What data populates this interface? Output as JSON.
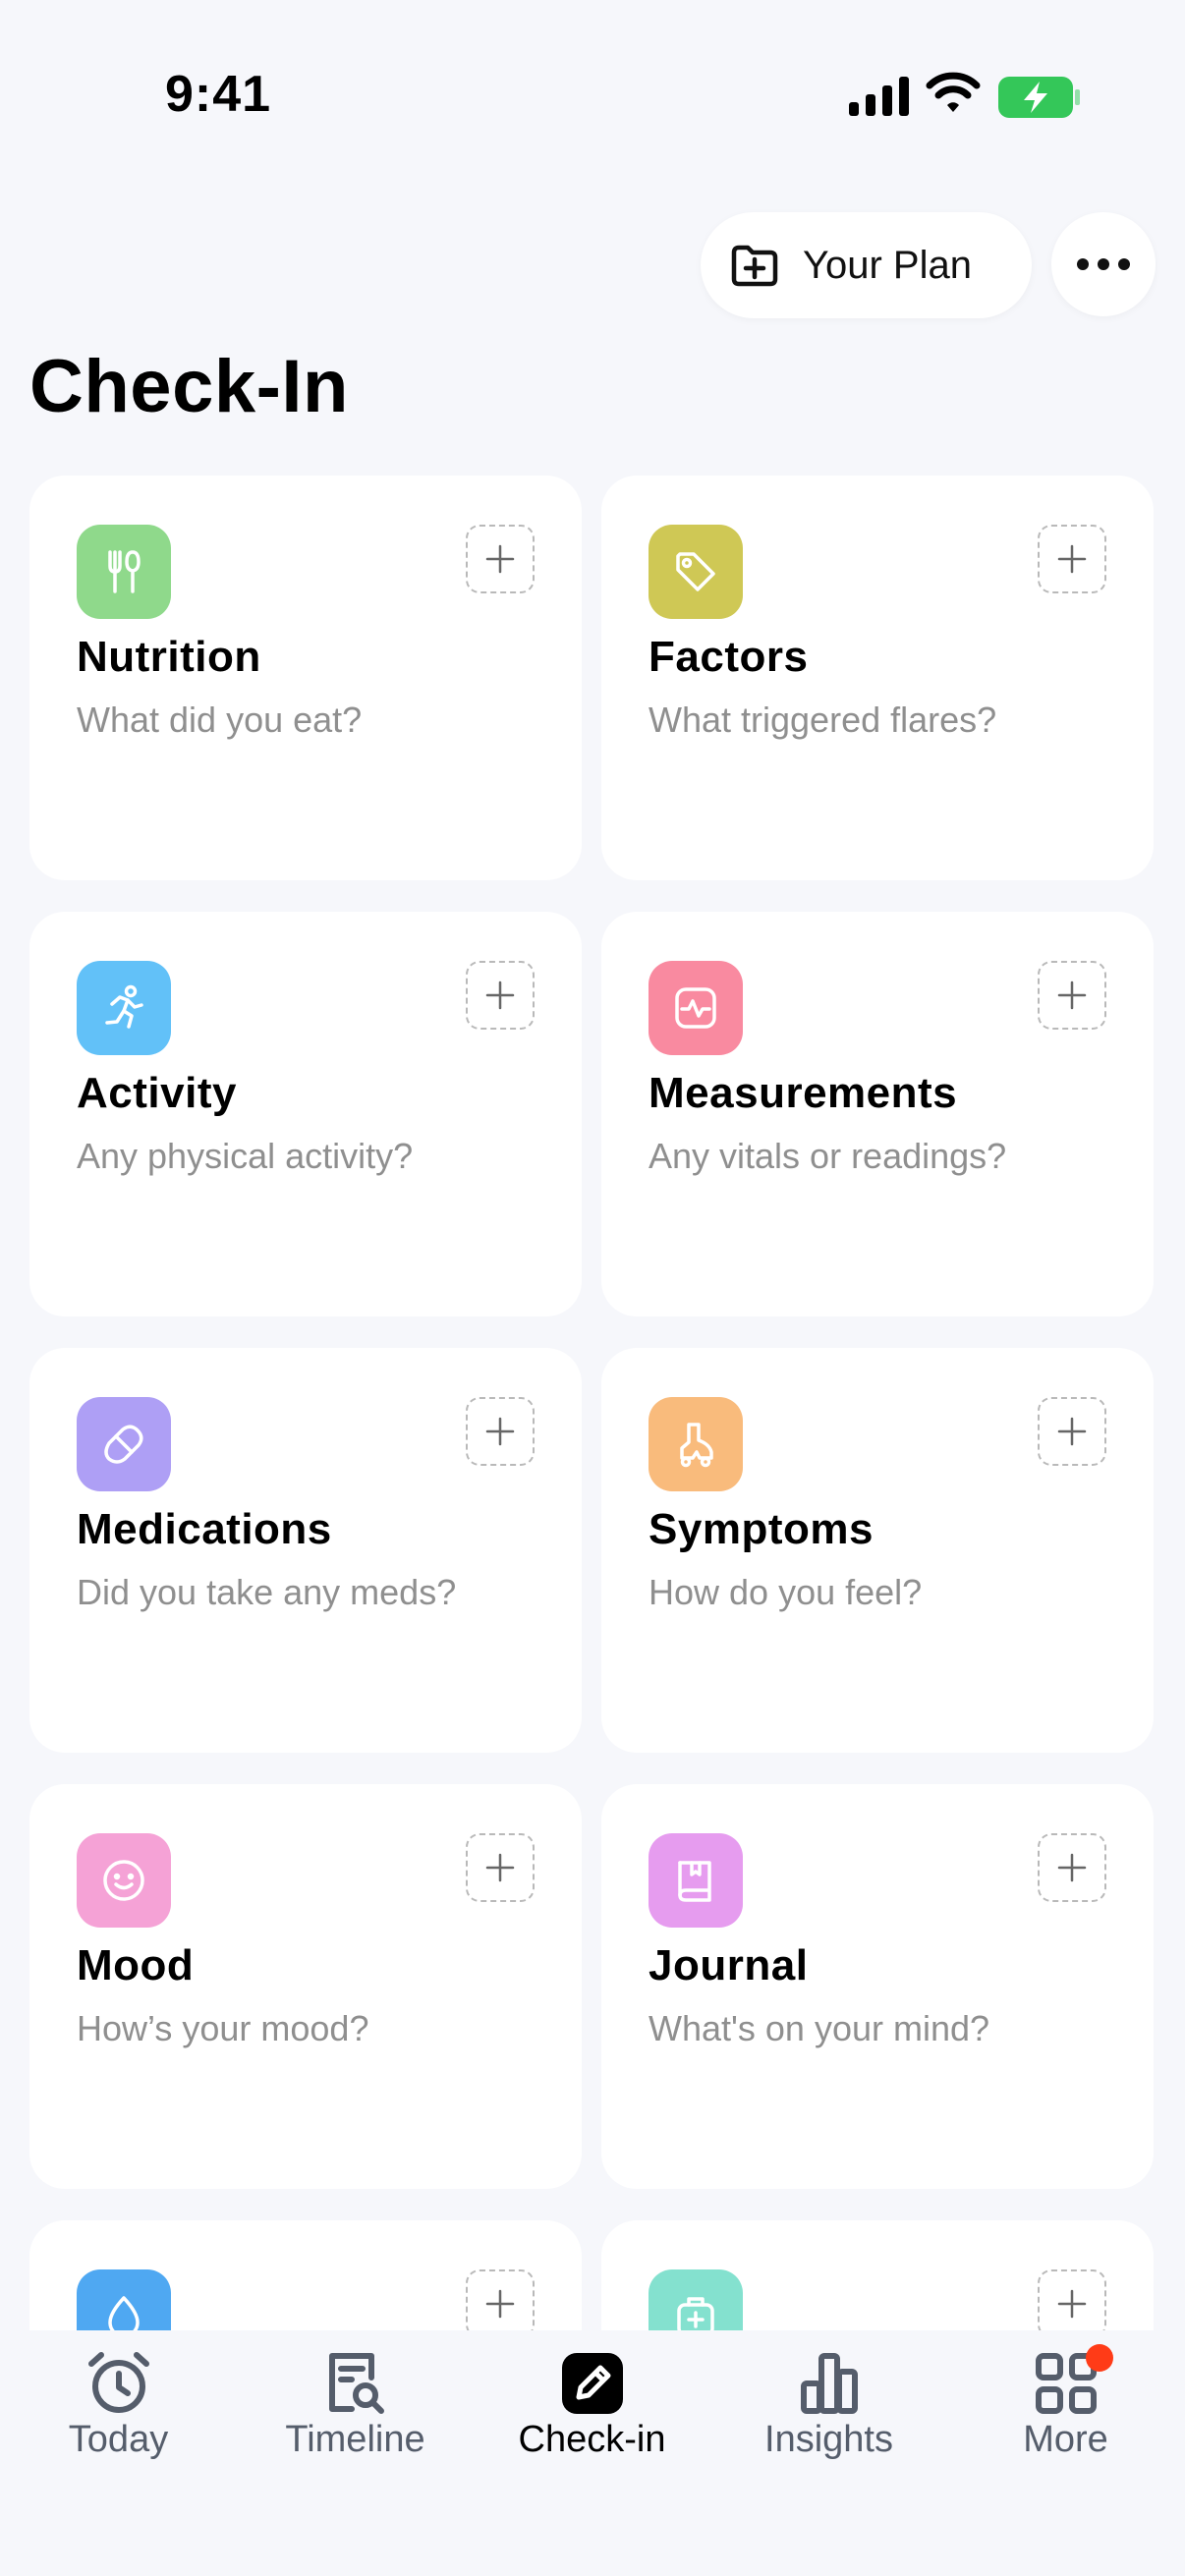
{
  "status_bar": {
    "time": "9:41"
  },
  "header": {
    "plan_label": "Your Plan",
    "title": "Check-In"
  },
  "cards": [
    {
      "title": "Nutrition",
      "subtitle": "What did you eat?",
      "icon": "utensils-icon",
      "color": "#8fd98b"
    },
    {
      "title": "Factors",
      "subtitle": "What triggered flares?",
      "icon": "tag-icon",
      "color": "#cfc855"
    },
    {
      "title": "Activity",
      "subtitle": "Any physical activity?",
      "icon": "running-icon",
      "color": "#62c1f8"
    },
    {
      "title": "Measurements",
      "subtitle": "Any vitals or readings?",
      "icon": "heart-monitor-icon",
      "color": "#f98aa0"
    },
    {
      "title": "Medications",
      "subtitle": "Did you take any meds?",
      "icon": "pill-icon",
      "color": "#ae9ff5"
    },
    {
      "title": "Symptoms",
      "subtitle": "How do you feel?",
      "icon": "body-icon",
      "color": "#f9bb7c"
    },
    {
      "title": "Mood",
      "subtitle": "How’s your mood?",
      "icon": "smile-icon",
      "color": "#f5a2d6"
    },
    {
      "title": "Journal",
      "subtitle": "What's on your mind?",
      "icon": "book-icon",
      "color": "#e69cef"
    },
    {
      "title": "",
      "subtitle": "",
      "icon": "water-drop-icon",
      "color": "#4fa8f2"
    },
    {
      "title": "",
      "subtitle": "",
      "icon": "medical-kit-icon",
      "color": "#84e1cf"
    }
  ],
  "tabs": [
    {
      "label": "Today",
      "icon": "alarm-clock-icon"
    },
    {
      "label": "Timeline",
      "icon": "document-search-icon"
    },
    {
      "label": "Check-in",
      "icon": "edit-icon",
      "active": true
    },
    {
      "label": "Insights",
      "icon": "bar-chart-icon"
    },
    {
      "label": "More",
      "icon": "grid-icon",
      "badge": true
    }
  ],
  "colors": {
    "background": "#f6f7fb",
    "card": "#ffffff",
    "subtitle": "#8f8f8f",
    "badge": "#ff3b17"
  }
}
